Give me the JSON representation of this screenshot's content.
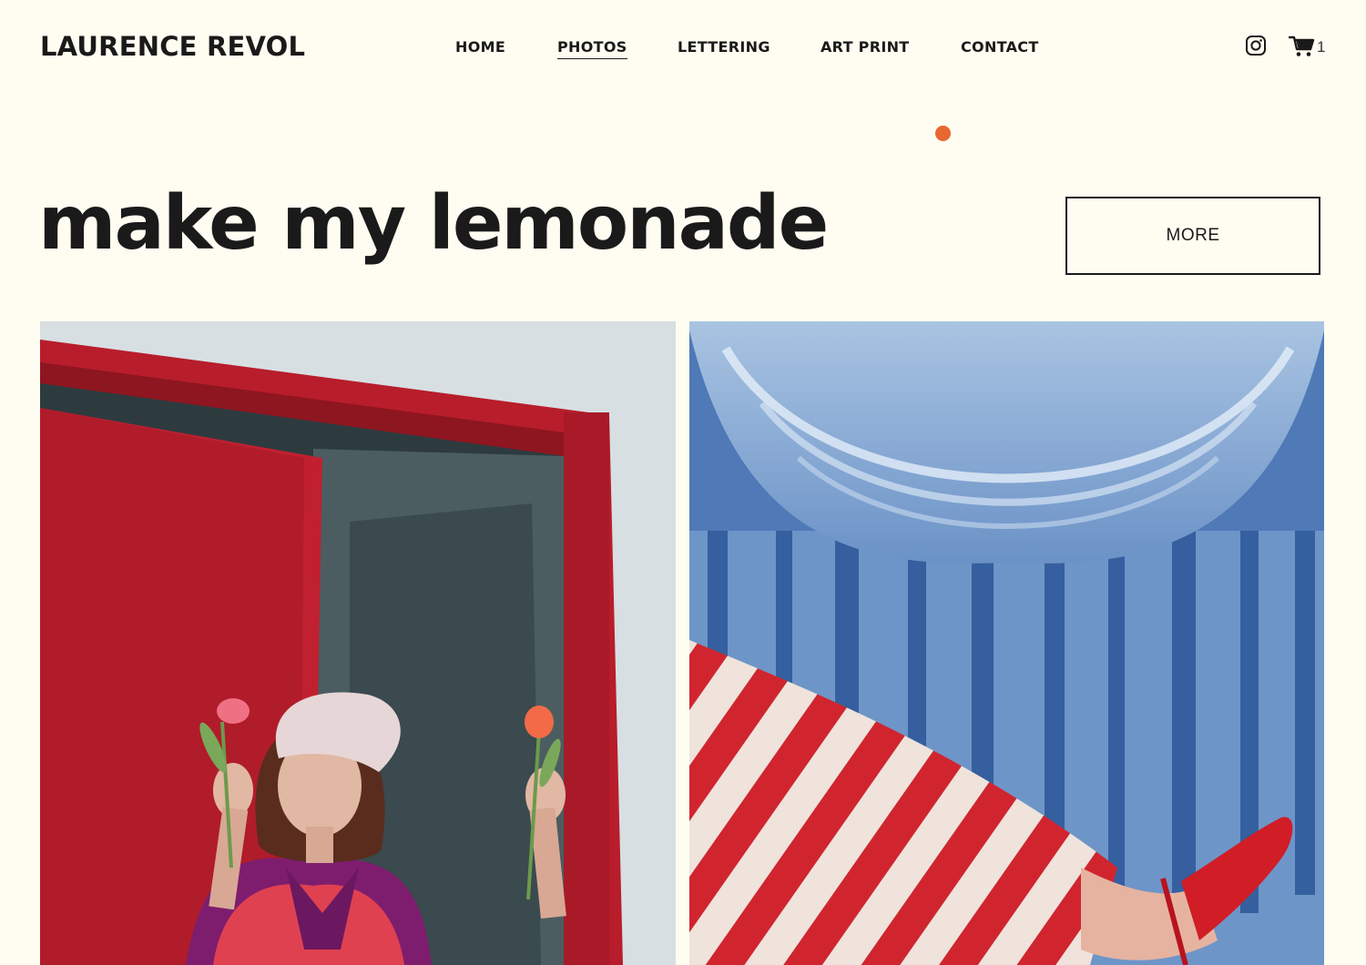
{
  "brand": {
    "name": "LAURENCE REVOL"
  },
  "nav": {
    "items": [
      {
        "label": "HOME",
        "active": false
      },
      {
        "label": "PHOTOS",
        "active": true
      },
      {
        "label": "LETTERING",
        "active": false
      },
      {
        "label": "ART PRINT",
        "active": false
      },
      {
        "label": "CONTACT",
        "active": false
      }
    ]
  },
  "header_icons": {
    "social": "instagram-icon",
    "cart": "cart-icon",
    "cart_count": "1"
  },
  "accent_color": "#e8662f",
  "hero": {
    "title": "make my lemonade",
    "more_label": "MORE"
  },
  "gallery": {
    "photos": [
      {
        "subject": "woman-in-beret-red-door"
      },
      {
        "subject": "striped-leg-blue-curtain"
      }
    ]
  }
}
